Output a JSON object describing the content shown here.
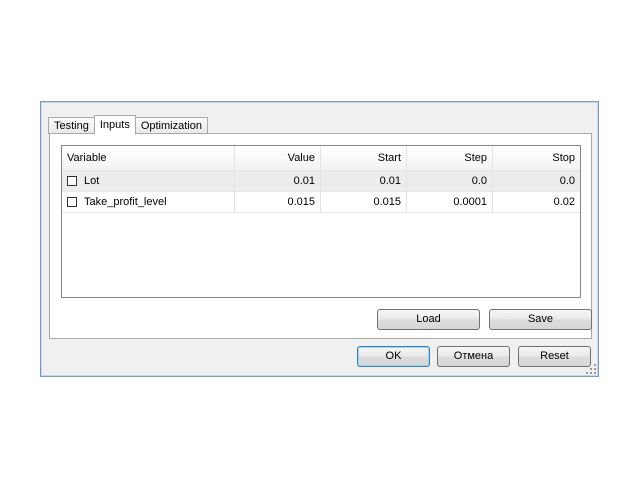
{
  "tabs": [
    {
      "label": "Testing",
      "active": false
    },
    {
      "label": "Inputs",
      "active": true
    },
    {
      "label": "Optimization",
      "active": false
    }
  ],
  "table": {
    "headers": {
      "variable": "Variable",
      "value": "Value",
      "start": "Start",
      "step": "Step",
      "stop": "Stop"
    },
    "rows": [
      {
        "variable": "Lot",
        "value": "0.01",
        "start": "0.01",
        "step": "0.0",
        "stop": "0.0",
        "checked": false,
        "selected": true
      },
      {
        "variable": "Take_profit_level",
        "value": "0.015",
        "start": "0.015",
        "step": "0.0001",
        "stop": "0.02",
        "checked": false,
        "selected": false
      }
    ]
  },
  "panel_buttons": {
    "load": "Load",
    "save": "Save"
  },
  "dialog_buttons": {
    "ok": "OK",
    "cancel": "Отмена",
    "reset": "Reset"
  }
}
